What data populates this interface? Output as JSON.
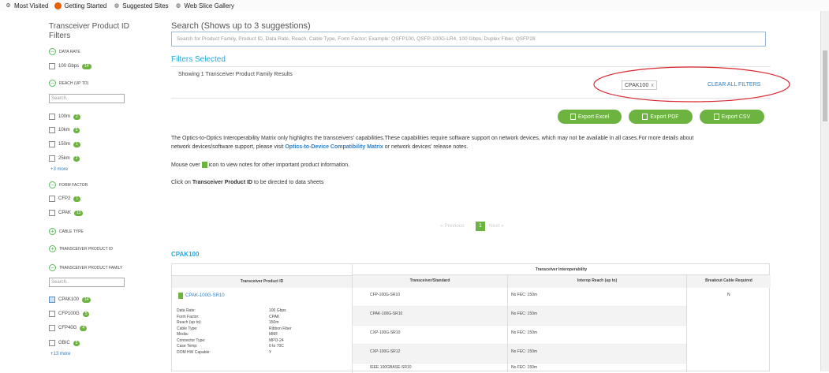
{
  "bookmarks": [
    {
      "label": "Most Visited",
      "icon": "gear-icon"
    },
    {
      "label": "Getting Started",
      "icon": "firefox-icon"
    },
    {
      "label": "Suggested Sites",
      "icon": "globe-icon"
    },
    {
      "label": "Web Slice Gallery",
      "icon": "globe-icon"
    }
  ],
  "sidebar": {
    "title": "Transceiver Product ID Filters",
    "data_rate": {
      "label": "DATA RATE",
      "options": [
        {
          "label": "100 Gbps",
          "count": "14"
        }
      ]
    },
    "reach": {
      "label": "REACH (up to)",
      "search_placeholder": "Search..",
      "options": [
        {
          "label": "100m",
          "count": "2"
        },
        {
          "label": "10km",
          "count": "5"
        },
        {
          "label": "150m",
          "count": "1"
        },
        {
          "label": "25km",
          "count": "2"
        }
      ],
      "more": "+3 more"
    },
    "form_factor": {
      "label": "FORM FACTOR",
      "options": [
        {
          "label": "CFP2",
          "count": "1"
        },
        {
          "label": "CPAK",
          "count": "13"
        }
      ]
    },
    "cable_type": {
      "label": "CABLE TYPE"
    },
    "transceiver_product_id": {
      "label": "TRANSCEIVER PRODUCT ID"
    },
    "family": {
      "label": "TRANSCEIVER PRODUCT FAMILY",
      "search_placeholder": "Search..",
      "options": [
        {
          "label": "CPAK100",
          "count": "14"
        },
        {
          "label": "CFP100G",
          "count": "5"
        },
        {
          "label": "CFP40G",
          "count": "4"
        },
        {
          "label": "GBIC",
          "count": "5"
        }
      ],
      "more": "+13 more"
    }
  },
  "search": {
    "title": "Search (Shows up to 3 suggestions)",
    "placeholder": "Search for Product Family, Product ID, Data Rate, Reach, Cable Type, Form Factor;  Example: QSFP100, QSFP-100G-LR4, 100 Gbps, Duplex Fiber, QSFP28"
  },
  "filters": {
    "heading": "Filters Selected",
    "result_text": "Showing 1 Transceiver Product Family Results",
    "chip": "CPAK100",
    "chip_x": "x",
    "clear_all": "CLEAR ALL FILTERS"
  },
  "export": {
    "excel": "Export Excel",
    "pdf": "Export PDF",
    "csv": "Export CSV"
  },
  "info": {
    "para1_a": "The Optics-to-Optics Interoperability Matrix only highlights the transceivers' capabilities.These capabilities require software support on network devices, which may not be available in all cases.For more details about",
    "para1_b": "network devices/software support, please visit ",
    "para1_link": "Optics-to-Device Compatibility Matrix",
    "para1_c": " or network devices' release notes.",
    "mouse_a": "Mouse over ",
    "mouse_b": " icon to view notes for other important product information.",
    "click_a": "Click on ",
    "click_b": "Transceiver Product ID",
    "click_c": " to be directed to data sheets"
  },
  "pagination": {
    "prev": "« Previous",
    "page": "1",
    "next": "Next »"
  },
  "family_heading": "CPAK100",
  "table": {
    "group_header": "Transceiver Interoperability",
    "col_pid": "Transceiver Product ID",
    "col_std": "Transceiver/Standard",
    "col_reach": "Interop Reach (up to)",
    "col_breakout": "Breakout Cable Required",
    "product_id": "CPAK-100G-SR10",
    "breakout": "N",
    "specs": [
      {
        "k": "Data Rate:",
        "v": "100 Gbps"
      },
      {
        "k": "Form Factor:",
        "v": "CPAK"
      },
      {
        "k": "Reach (up to):",
        "v": "150m"
      },
      {
        "k": "Cable Type:",
        "v": "Ribbon Fiber"
      },
      {
        "k": "Media:",
        "v": "MMF"
      },
      {
        "k": "Connector Type:",
        "v": "MPO-24"
      },
      {
        "k": "Case Temp:",
        "v": "0 to 70C"
      },
      {
        "k": "DOM HW Capable:",
        "v": "Y"
      }
    ],
    "rows": [
      {
        "std": "CFP-100G-SR10",
        "reach": "No FEC: 150m"
      },
      {
        "std": "CPAK-100G-SR10",
        "reach": "No FEC: 150m"
      },
      {
        "std": "CXP-100G-SR10",
        "reach": "No FEC: 150m"
      },
      {
        "std": "CXP-100G-SR12",
        "reach": "No FEC: 150m"
      },
      {
        "std": "IEEE 100GBASE-SR10",
        "reach": "No FEC: 150m"
      }
    ]
  },
  "colors": {
    "accent_green": "#6db33f",
    "link_blue": "#2f7ec1",
    "annotation_red": "#d9262e"
  }
}
